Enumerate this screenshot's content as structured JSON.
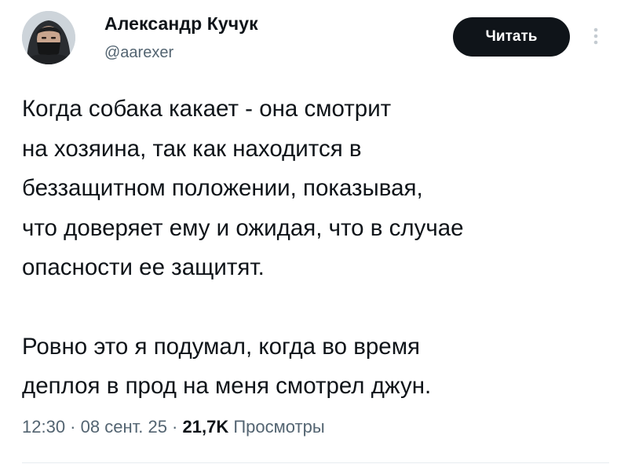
{
  "author": {
    "name": "Александр Кучук",
    "handle": "@aarexer"
  },
  "actions": {
    "follow_label": "Читать",
    "more_icon": "vertical-dots-icon"
  },
  "tweet": {
    "paragraph_1": "Когда собака какает - она смотрит\nна хозяина, так как находится в\nбеззащитном положении, показывая,\nчто доверяет ему и ожидая, что в случае\nопасности ее защитят.",
    "paragraph_2": "Ровно это я подумал, когда во время\nдеплоя в прод на меня смотрел джун."
  },
  "meta": {
    "time": "12:30",
    "separator": " · ",
    "date": "08 сент. 25",
    "views_count": "21,7K",
    "views_label": "Просмотры"
  },
  "colors": {
    "text": "#0f1419",
    "secondary_text": "#536471",
    "button_bg": "#0f1419",
    "button_text": "#ffffff",
    "divider": "#e6ecf0"
  }
}
